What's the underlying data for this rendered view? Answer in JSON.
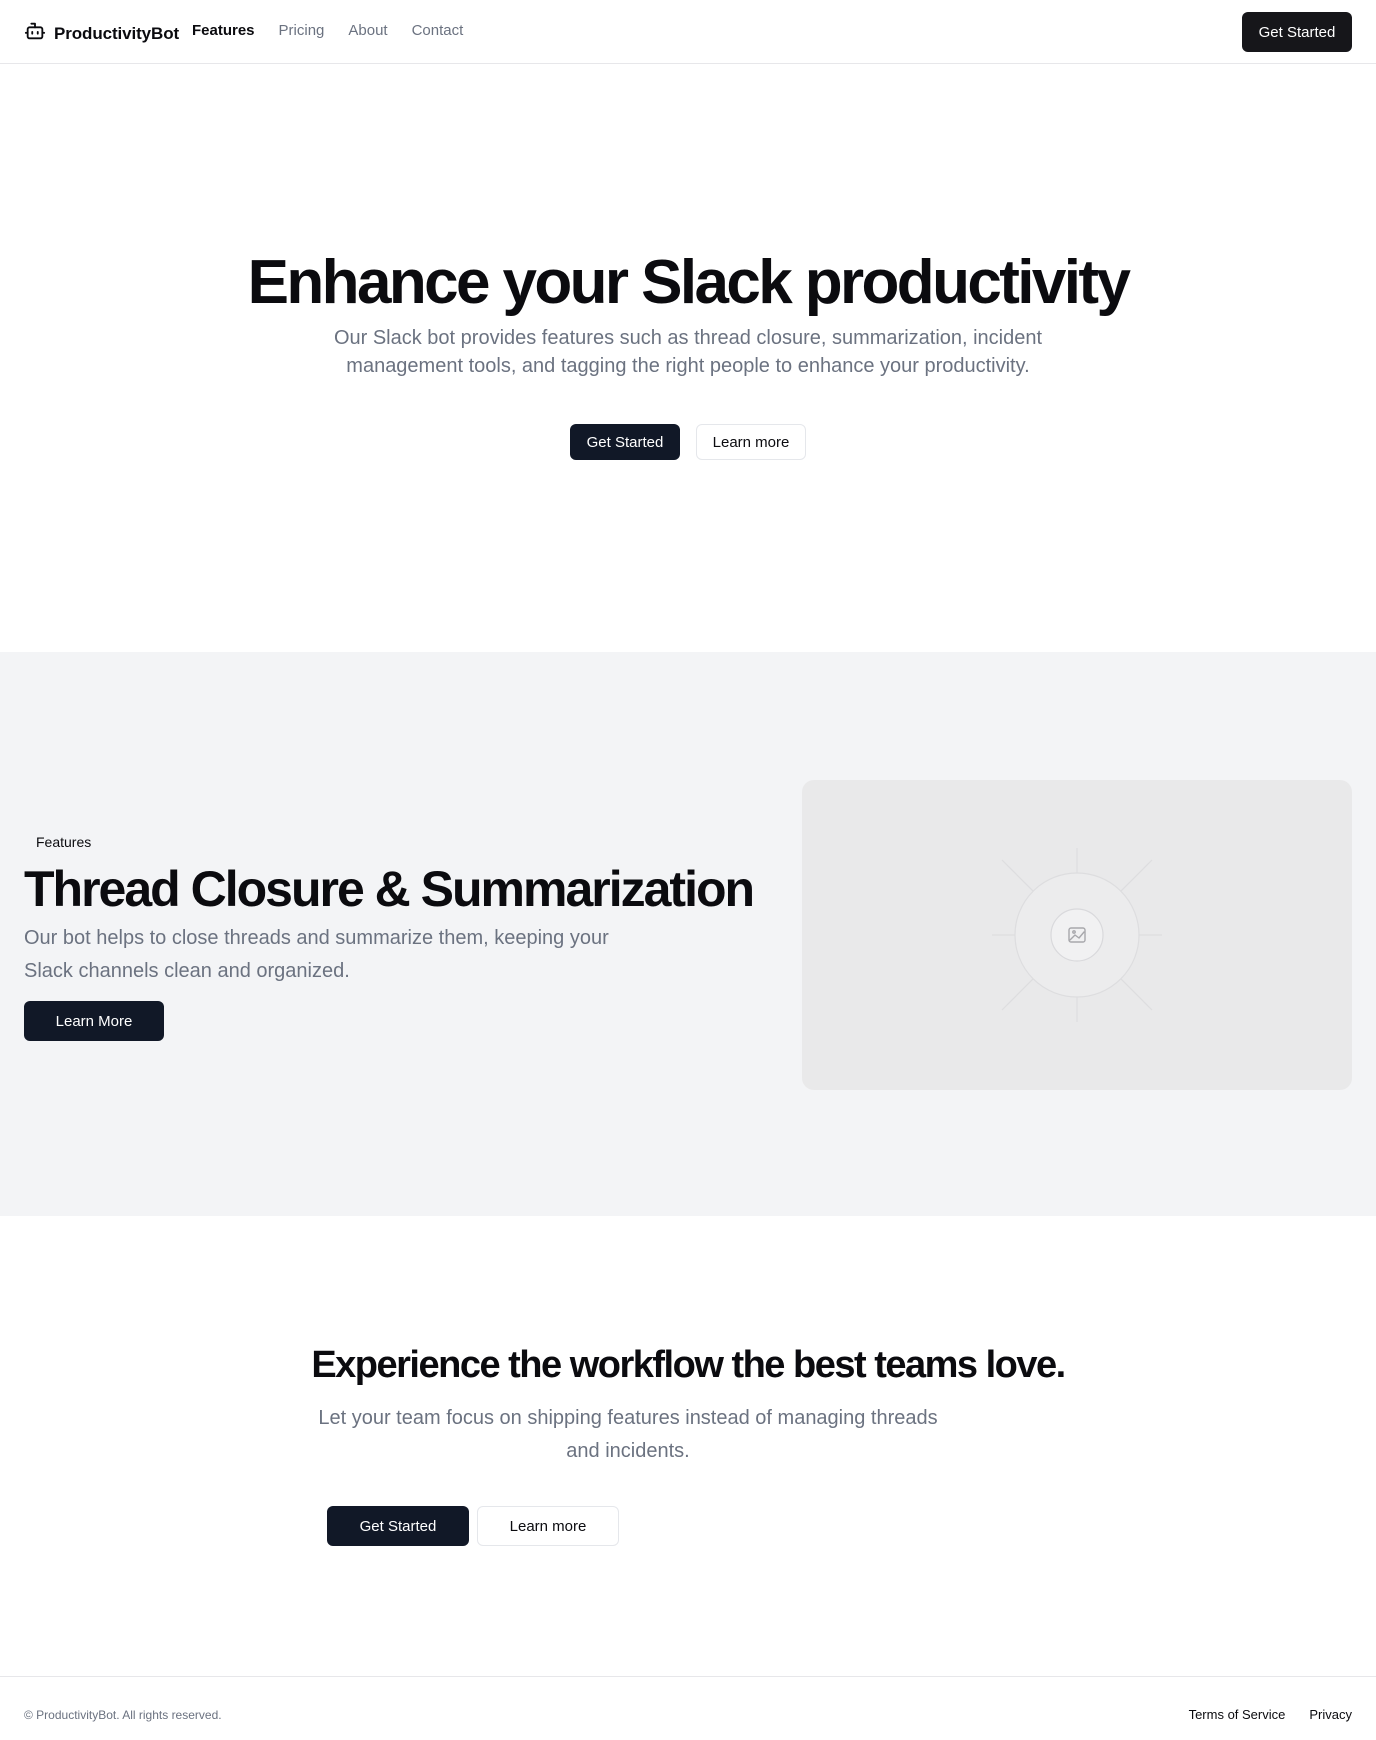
{
  "header": {
    "brand": "ProductivityBot",
    "nav": [
      {
        "label": "Features",
        "active": true
      },
      {
        "label": "Pricing",
        "active": false
      },
      {
        "label": "About",
        "active": false
      },
      {
        "label": "Contact",
        "active": false
      }
    ],
    "cta_label": "Get Started"
  },
  "hero": {
    "title": "Enhance your Slack productivity",
    "subtitle": "Our Slack bot provides features such as thread closure, summarization, incident management tools, and tagging the right people to enhance your productivity.",
    "primary_label": "Get Started",
    "secondary_label": "Learn more"
  },
  "features": {
    "tag": "Features",
    "title": "Thread Closure & Summarization",
    "description": "Our bot helps to close threads and summarize them, keeping your Slack channels clean and organized.",
    "button_label": "Learn More",
    "image_icon": "image-placeholder-icon"
  },
  "cta": {
    "title": "Experience the workflow the best teams love.",
    "subtitle": "Let your team focus on shipping features instead of managing threads and incidents.",
    "primary_label": "Get Started",
    "secondary_label": "Learn more"
  },
  "footer": {
    "copyright": "© ProductivityBot. All rights reserved.",
    "links": [
      "Terms of Service",
      "Privacy"
    ]
  },
  "colors": {
    "primary": "#111827",
    "muted_text": "#6b7280",
    "section_bg": "#f3f4f6"
  }
}
